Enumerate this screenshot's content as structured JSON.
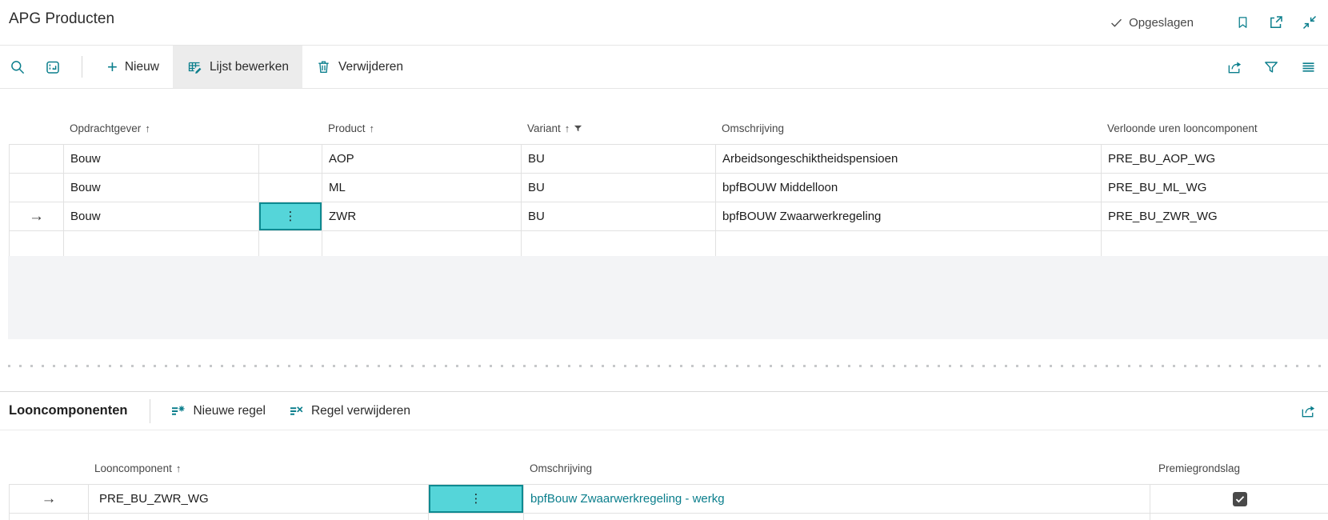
{
  "icons": {
    "sort_asc": "↑",
    "ellipsis_v": "⋮",
    "arrow_right": "→",
    "plus": "+"
  },
  "titlebar": {
    "title": "APG Producten",
    "saved": "Opgeslagen"
  },
  "toolbar": {
    "new": "Nieuw",
    "edit_list": "Lijst bewerken",
    "delete": "Verwijderen"
  },
  "top_grid": {
    "headers": {
      "opdrachtgever": "Opdrachtgever",
      "product": "Product",
      "variant": "Variant",
      "omschrijving": "Omschrijving",
      "verloonde": "Verloonde uren looncomponent"
    },
    "rows": [
      {
        "opdrachtgever": "Bouw",
        "product": "AOP",
        "variant": "BU",
        "omschrijving": "Arbeidsongeschiktheidspensioen",
        "verloonde": "PRE_BU_AOP_WG"
      },
      {
        "opdrachtgever": "Bouw",
        "product": "ML",
        "variant": "BU",
        "omschrijving": "bpfBOUW Middelloon",
        "verloonde": "PRE_BU_ML_WG"
      },
      {
        "opdrachtgever": "Bouw",
        "product": "ZWR",
        "variant": "BU",
        "omschrijving": "bpfBOUW Zwaarwerkregeling",
        "verloonde": "PRE_BU_ZWR_WG"
      }
    ]
  },
  "section": {
    "title": "Looncomponenten",
    "new_line": "Nieuwe regel",
    "delete_line": "Regel verwijderen"
  },
  "bottom_grid": {
    "headers": {
      "looncomponent": "Looncomponent",
      "omschrijving": "Omschrijving",
      "premiegrondslag": "Premiegrondslag"
    },
    "rows": [
      {
        "looncomponent": "PRE_BU_ZWR_WG",
        "omschrijving": "bpfBouw Zwaarwerkregeling - werkg",
        "premiegrondslag_checked": true
      }
    ]
  },
  "colors": {
    "accent_teal": "#0a7e8c",
    "selected_cell_fill": "#55d5d9",
    "selected_cell_border": "#0e8a91",
    "link": "#0a7e8c",
    "grid_border": "#e1e1e1",
    "filler_gray": "#f3f4f6"
  }
}
